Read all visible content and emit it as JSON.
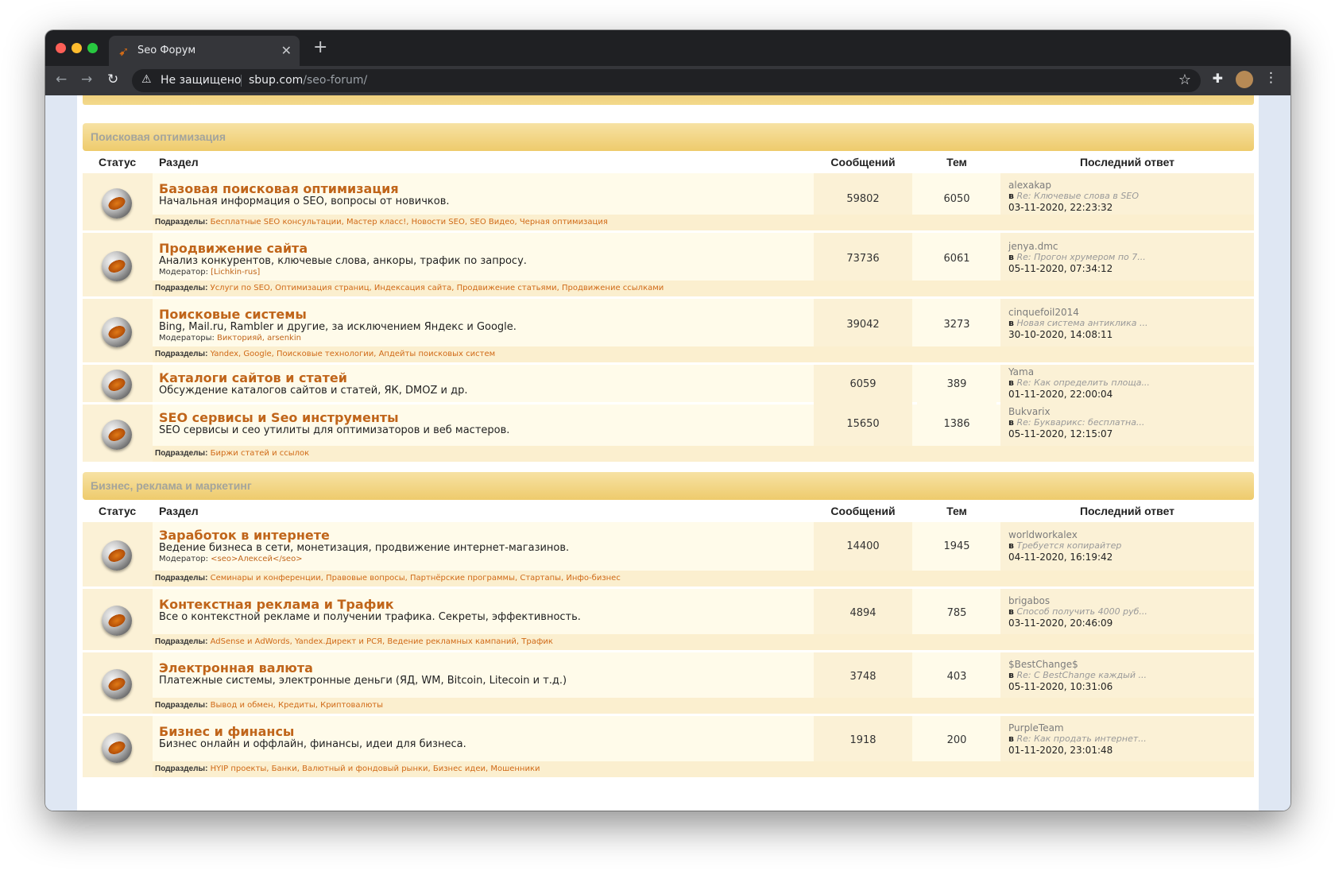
{
  "browser": {
    "tab_title": "Seo Форум",
    "secure_label": "Не защищено",
    "url_host": "sbup.com",
    "url_path": "/seo-forum/"
  },
  "columns": {
    "status": "Статус",
    "section": "Раздел",
    "messages": "Сообщений",
    "topics": "Тем",
    "last_reply": "Последний ответ"
  },
  "labels": {
    "subforums": "Подразделы:",
    "in": "в"
  },
  "sections": [
    {
      "title": "Поисковая оптимизация",
      "forums": [
        {
          "title": "Базовая поисковая оптимизация",
          "description": "Начальная информация о SEO, вопросы от новичков.",
          "moderator_label": "",
          "moderators": "",
          "messages": "59802",
          "topics": "6050",
          "last_user": "alexakap",
          "last_topic": "Re: Ключевые слова в SEO",
          "last_date": "03-11-2020, 22:23:32",
          "subforums": "Бесплатные SEO консультации, Мастер класс!, Новости SEO, SEO Видео, Черная оптимизация"
        },
        {
          "title": "Продвижение сайта",
          "description": "Анализ конкурентов, ключевые слова, анкоры, трафик по запросу.",
          "moderator_label": "Модератор:",
          "moderators": "[Lichkin-rus]",
          "messages": "73736",
          "topics": "6061",
          "last_user": "jenya.dmc",
          "last_topic": "Re: Прогон хрумером по 7...",
          "last_date": "05-11-2020, 07:34:12",
          "subforums": "Услуги по SEO, Оптимизация страниц, Индексация сайта, Продвижение статьями, Продвижение ссылками"
        },
        {
          "title": "Поисковые системы",
          "description": "Bing, Mail.ru, Rambler и другие, за исключением Яндекс и Google.",
          "moderator_label": "Модераторы:",
          "moderators": "Викторияй, arsenkin",
          "messages": "39042",
          "topics": "3273",
          "last_user": "cinquefoil2014",
          "last_topic": "Новая система антиклика ...",
          "last_date": "30-10-2020, 14:08:11",
          "subforums": "Yandex, Google, Поисковые технологии, Апдейты поисковых систем"
        },
        {
          "title": "Каталоги сайтов и статей",
          "description": "Обсуждение каталогов сайтов и статей, ЯК, DMOZ и др.",
          "moderator_label": "",
          "moderators": "",
          "messages": "6059",
          "topics": "389",
          "last_user": "Yama",
          "last_topic": "Re: Как определить площа...",
          "last_date": "01-11-2020, 22:00:04",
          "subforums": ""
        },
        {
          "title": "SEO сервисы и Seo инструменты",
          "description": "SEO сервисы и сео утилиты для оптимизаторов и веб мастеров.",
          "moderator_label": "",
          "moderators": "",
          "messages": "15650",
          "topics": "1386",
          "last_user": "Bukvarix",
          "last_topic": "Re: Букварикс: бесплатна...",
          "last_date": "05-11-2020, 12:15:07",
          "subforums": "Биржи статей и ссылок"
        }
      ]
    },
    {
      "title": "Бизнес, реклама и маркетинг",
      "forums": [
        {
          "title": "Заработок в интернете",
          "description": "Ведение бизнеса в сети, монетизация, продвижение интернет-магазинов.",
          "moderator_label": "Модератор:",
          "moderators": "<seo>Алексей</seo>",
          "messages": "14400",
          "topics": "1945",
          "last_user": "worldworkalex",
          "last_topic": "Требуется копирайтер",
          "last_date": "04-11-2020, 16:19:42",
          "subforums": "Семинары и конференции, Правовые вопросы, Партнёрские программы, Стартапы, Инфо-бизнес"
        },
        {
          "title": "Контекстная реклама и Трафик",
          "description": "Все о контекстной рекламе и получении трафика. Секреты, эффективность.",
          "moderator_label": "",
          "moderators": "",
          "messages": "4894",
          "topics": "785",
          "last_user": "brigabos",
          "last_topic": "Способ получить 4000 руб...",
          "last_date": "03-11-2020, 20:46:09",
          "subforums": "AdSense и AdWords, Yandex.Директ и РСЯ, Ведение рекламных кампаний, Трафик"
        },
        {
          "title": "Электронная валюта",
          "description": "Платежные системы, электронные деньги (ЯД, WM, Bitcoin, Litecoin и т.д.)",
          "moderator_label": "",
          "moderators": "",
          "messages": "3748",
          "topics": "403",
          "last_user": "$BestChange$",
          "last_topic": "Re: С BestChange каждый ...",
          "last_date": "05-11-2020, 10:31:06",
          "subforums": "Вывод и обмен, Кредиты, Криптовалюты"
        },
        {
          "title": "Бизнес и финансы",
          "description": "Бизнес онлайн и оффлайн, финансы, идеи для бизнеса.",
          "moderator_label": "",
          "moderators": "",
          "messages": "1918",
          "topics": "200",
          "last_user": "PurpleTeam",
          "last_topic": "Re: Как продать интернет...",
          "last_date": "01-11-2020, 23:01:48",
          "subforums": "HYIP проекты, Банки, Валютный и фондовый рынки, Бизнес идеи, Мошенники"
        }
      ]
    }
  ]
}
